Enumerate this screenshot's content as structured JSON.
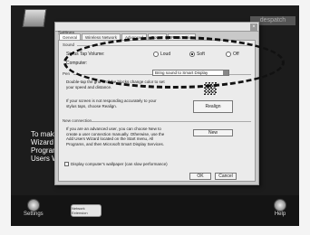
{
  "desktop": {
    "brand": "despatch",
    "bg_text": [
      "To make a c",
      "Wizard on y",
      "Programs, a",
      "Users Wiza"
    ]
  },
  "taskbar": {
    "settings_label": "Settings",
    "help_label": "Help",
    "small_button_label": "Network Extension"
  },
  "dialog": {
    "title": "Settings",
    "tabs": [
      "General",
      "Wireless Network",
      "Advanced",
      "Power",
      "Pen&Tablet"
    ],
    "active_tab": 0,
    "sound": {
      "section": "Sound",
      "stylus_label": "Stylus Tap Volume:",
      "options": [
        "Loud",
        "Soft",
        "Off"
      ],
      "selected": "Soft",
      "computer_label": "Computer:",
      "computer_value": "Bring sound to Smart Display"
    },
    "pen": {
      "section": "Pen",
      "instruction": "Double-tap the grid until the blocks change color to set your speed and distance.",
      "realign_text": "If your screen is not responding accurately to your stylus taps, choose Realign.",
      "realign_button": "Realign"
    },
    "connection": {
      "section": "New connection",
      "text": "If you are an advanced user, you can choose New to create a user connection manually. Otherwise, use the Add Users Wizard located on the Start menu, All Programs, and then Microsoft Smart Display Services.",
      "new_button": "New"
    },
    "wallpaper_label": "Display computer's wallpaper (can slow performance)",
    "ok_label": "OK",
    "cancel_label": "Cancel"
  }
}
